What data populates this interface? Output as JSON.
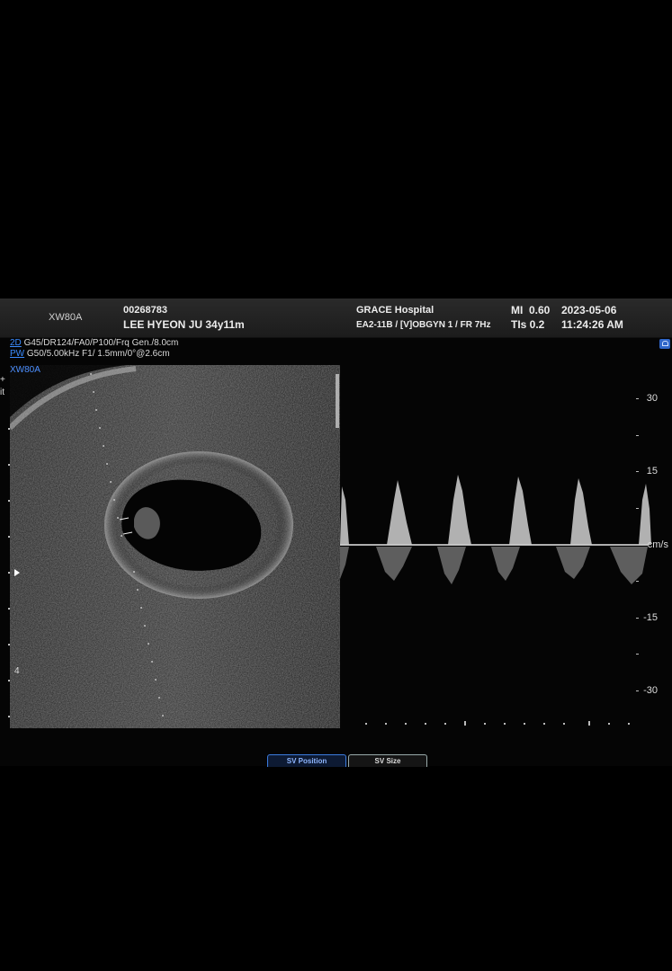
{
  "header": {
    "model": "XW80A",
    "patient_id": "00268783",
    "patient_name": "LEE HYEON JU 34y11m",
    "hospital": "GRACE Hospital",
    "preset": "EA2-11B / [V]OBGYN 1 / FR 7Hz",
    "mi_label": "MI",
    "mi_value": "0.60",
    "tis": "TIs 0.2",
    "date": "2023-05-06",
    "time": "11:24:26 AM"
  },
  "params": {
    "mode_2d": "2D",
    "params_2d": "G45/DR124/FA0/P100/Frq Gen./8.0cm",
    "mode_pw": "PW",
    "params_pw": "G50/5.00kHz F1/ 1.5mm/0°@2.6cm"
  },
  "bmode": {
    "label": "XW80A",
    "depth_marker": "4"
  },
  "doppler": {
    "scale": [
      "30",
      "15",
      "cm/s",
      "-15",
      "-30"
    ],
    "unit": "cm/s"
  },
  "footer": {
    "sv_position": "SV Position",
    "sv_size": "SV Size"
  },
  "icons": {
    "lock": "lock-icon",
    "marker": "focus-marker-icon"
  },
  "colors": {
    "mode_accent": "#3b8cff",
    "background": "#000000",
    "header_bar": "#242424"
  }
}
